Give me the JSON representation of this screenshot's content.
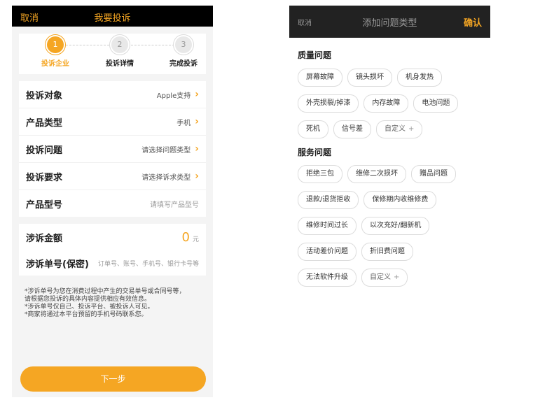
{
  "left": {
    "topbar": {
      "cancel": "取消",
      "title": "我要投诉"
    },
    "steps": [
      {
        "num": "1",
        "label": "投诉企业",
        "active": true
      },
      {
        "num": "2",
        "label": "投诉详情",
        "active": false
      },
      {
        "num": "3",
        "label": "完成投诉",
        "active": false
      }
    ],
    "form": {
      "target_label": "投诉对象",
      "target_value": "Apple支持",
      "product_type_label": "产品类型",
      "product_type_value": "手机",
      "issue_label": "投诉问题",
      "issue_placeholder": "请选择问题类型",
      "request_label": "投诉要求",
      "request_placeholder": "请选择诉求类型",
      "model_label": "产品型号",
      "model_placeholder": "请填写产品型号"
    },
    "amount": {
      "label": "涉诉金额",
      "value": "0",
      "unit": "元"
    },
    "order": {
      "label": "涉诉单号(保密)",
      "placeholder": "订单号、账号、手机号、银行卡号等"
    },
    "notes": [
      "*涉诉单号为您在消费过程中产生的交易单号或合同号等，",
      "请根据您投诉的具体内容提供相应有效信息。",
      "*涉诉单号仅自己、投诉平台、被投诉人可见。",
      "*商家将通过本平台预留的手机号码联系您。"
    ],
    "next_button": "下一步"
  },
  "right": {
    "topbar": {
      "cancel": "取消",
      "title": "添加问题类型",
      "confirm": "确认"
    },
    "quality": {
      "title": "质量问题",
      "row1": [
        "屏幕故障",
        "镜头损坏",
        "机身发热"
      ],
      "row2": [
        "外壳损裂/掉漆",
        "内存故障",
        "电池问题"
      ],
      "row3": [
        "死机",
        "信号差"
      ],
      "custom": "自定义"
    },
    "service": {
      "title": "服务问题",
      "row1": [
        "拒绝三包",
        "维修二次损坏",
        "赠品问题"
      ],
      "row2": [
        "退款/退货拒收",
        "保修期内收维修费"
      ],
      "row3": [
        "维修时间过长",
        "以次充好/翻新机"
      ],
      "row4": [
        "活动差价问题",
        "折旧费问题"
      ],
      "row5": [
        "无法软件升级"
      ],
      "custom": "自定义"
    }
  },
  "colors": {
    "accent": "#f5a623",
    "topbar_left": "#000000",
    "topbar_right": "#222222"
  }
}
